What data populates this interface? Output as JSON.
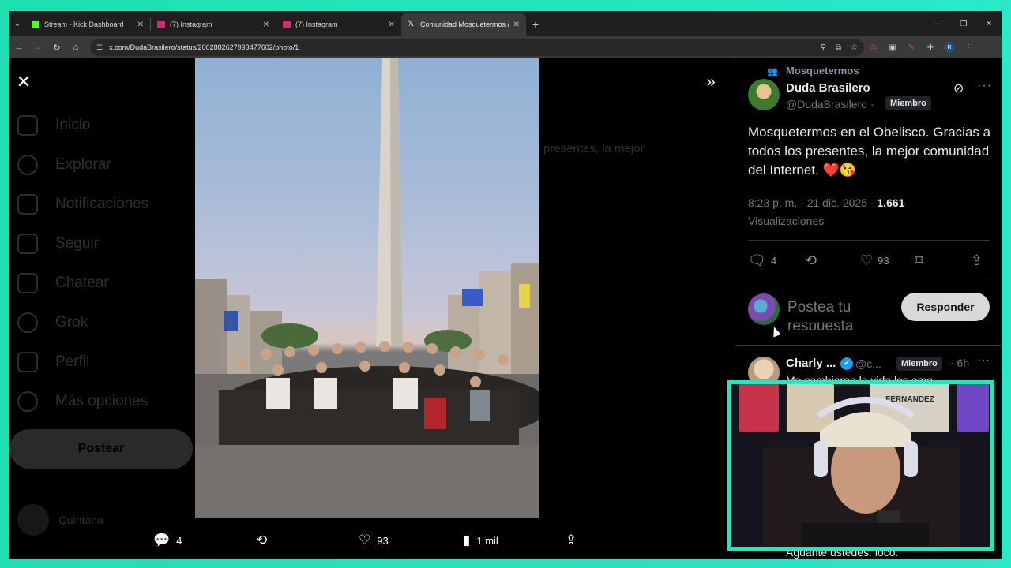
{
  "tabs": [
    {
      "label": "Stream - Kick Dashboard",
      "favicon_color": "#53fc18",
      "active": false
    },
    {
      "label": "(7) Instagram",
      "favicon_color": "#d62976",
      "active": false
    },
    {
      "label": "(7) Instagram",
      "favicon_color": "#d62976",
      "active": false
    },
    {
      "label": "Comunidad Mosquetermos / X",
      "favicon_color": "#ffffff",
      "active": true
    }
  ],
  "address_bar": {
    "url": "x.com/DudaBrasilero/status/2002882627993477602/photo/1"
  },
  "left_nav": {
    "items": [
      "Inicio",
      "Explorar",
      "Notificaciones",
      "Seguir",
      "Chatear",
      "Grok",
      "Perfil",
      "Más opciones"
    ],
    "post_button": "Postear",
    "profile_name": "Quintana"
  },
  "background_text": "presentes, la mejor",
  "photo_actions": {
    "replies": "4",
    "likes": "93",
    "views": "1 mil"
  },
  "tweet": {
    "community": "Mosquetermos",
    "author_name": "Duda Brasilero",
    "author_handle": "@DudaBrasilero",
    "separator": "·",
    "member_badge": "Miembro",
    "text": "Mosquetermos en el Obelisco. Gracias a todos los presentes, la mejor comunidad del Internet. ❤️😘",
    "time": "8:23 p. m. · 21 dic. 2025 · ",
    "views_count": "1.661",
    "views_label": "Visualizaciones",
    "replies": "4",
    "likes": "93"
  },
  "reply_box": {
    "placeholder": "Postea tu respuesta",
    "button": "Responder"
  },
  "comments": [
    {
      "name": "Charly ...",
      "handle": "@c...",
      "badge": "Miembro",
      "time": "· 6h",
      "text": "Me cambiaron la vida los amo"
    },
    {
      "text": "Aguante ustedes. loco."
    }
  ],
  "webcam_sign": "FERNANDEZ",
  "colors": {
    "frame": "#22e3b8",
    "verified": "#1d9bf0",
    "heart": "#f4212e"
  }
}
